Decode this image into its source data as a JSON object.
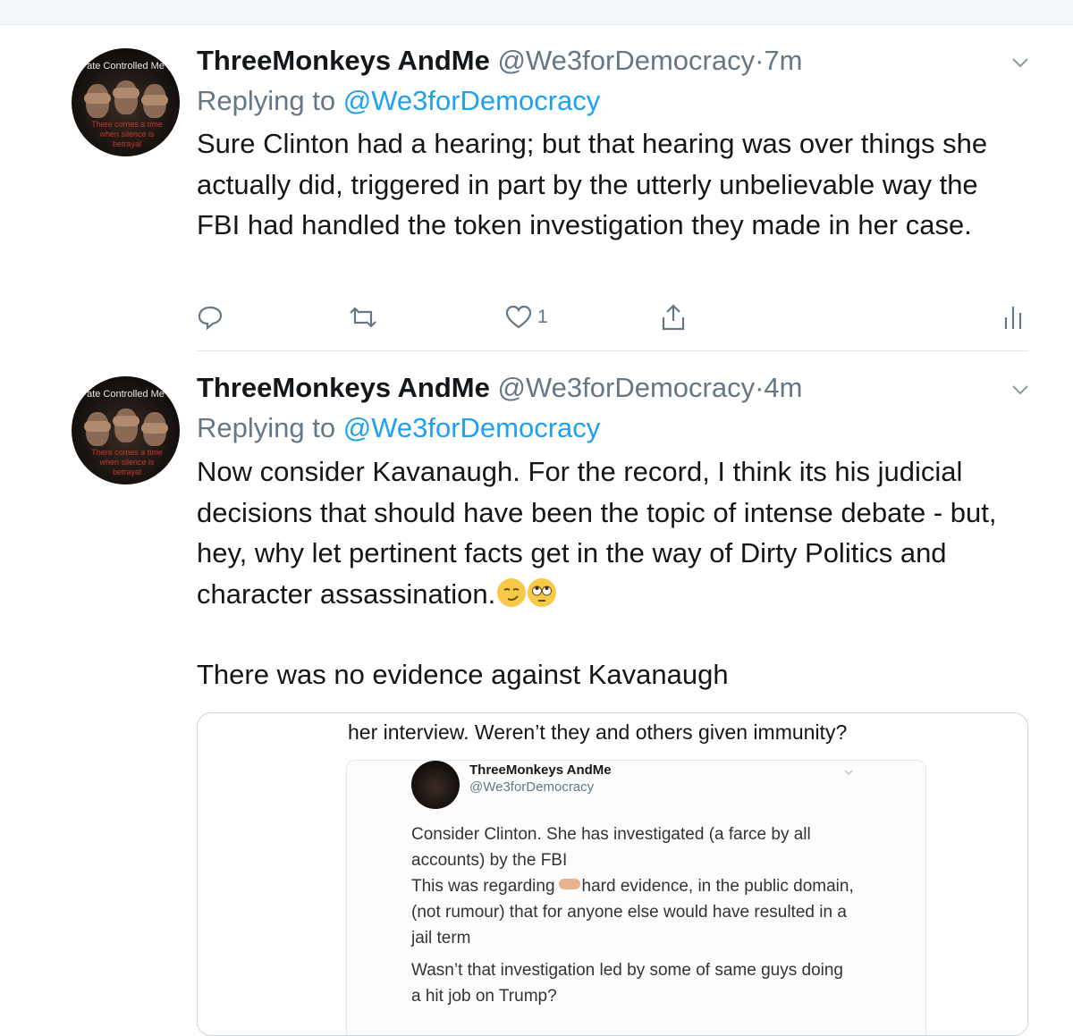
{
  "tweets": [
    {
      "author_name": "ThreeMonkeys AndMe",
      "author_handle": "@We3forDemocracy",
      "separator": "·",
      "time": "7m",
      "replying_prefix": "Replying to",
      "replying_to": "@We3forDemocracy",
      "avatar_banner": "ate Controlled Me",
      "avatar_caption": "There comes a time when silence is betrayal",
      "body": "Sure Clinton had a hearing; but that hearing was over things she actually did, triggered in part by the utterly unbelievable way the FBI had handled the token investigation they made in her case.",
      "like_count": "1"
    },
    {
      "author_name": "ThreeMonkeys AndMe",
      "author_handle": "@We3forDemocracy",
      "separator": "·",
      "time": "4m",
      "replying_prefix": "Replying to",
      "replying_to": "@We3forDemocracy",
      "avatar_banner": "ate Controlled Me",
      "avatar_caption": "There comes a time when silence is betrayal",
      "body": "Now consider Kavanaugh. For the record, I think its his judicial decisions that should have been the topic of intense debate - but, hey, why let pertinent facts get in the way of Dirty Politics and character assassination.",
      "body_emojis": [
        "smirking-face",
        "face-with-rolling-eyes"
      ],
      "body_second": "There was no evidence against Kavanaugh"
    }
  ],
  "attached_image": {
    "cut_text": "her interview. Weren’t they and others given immunity?",
    "inner_tweet": {
      "author_name": "ThreeMonkeys AndMe",
      "author_handle": "@We3forDemocracy",
      "line1": "Consider Clinton. She has investigated (a farce by all",
      "line2": "accounts) by the FBI",
      "line3_before": "This was regarding",
      "line3_emoji": "pointing-hand",
      "line3_after": "hard evidence, in the public domain,",
      "line4": "(not rumour) that for anyone else would have resulted in a",
      "line5": "jail term",
      "line6": "Wasn’t that investigation led by some of same guys doing",
      "line7": "a hit job on Trump?"
    }
  },
  "colors": {
    "link": "#1da1f2",
    "secondary_text": "#657786",
    "primary_text": "#14171a",
    "divider": "#e1e8ed"
  }
}
